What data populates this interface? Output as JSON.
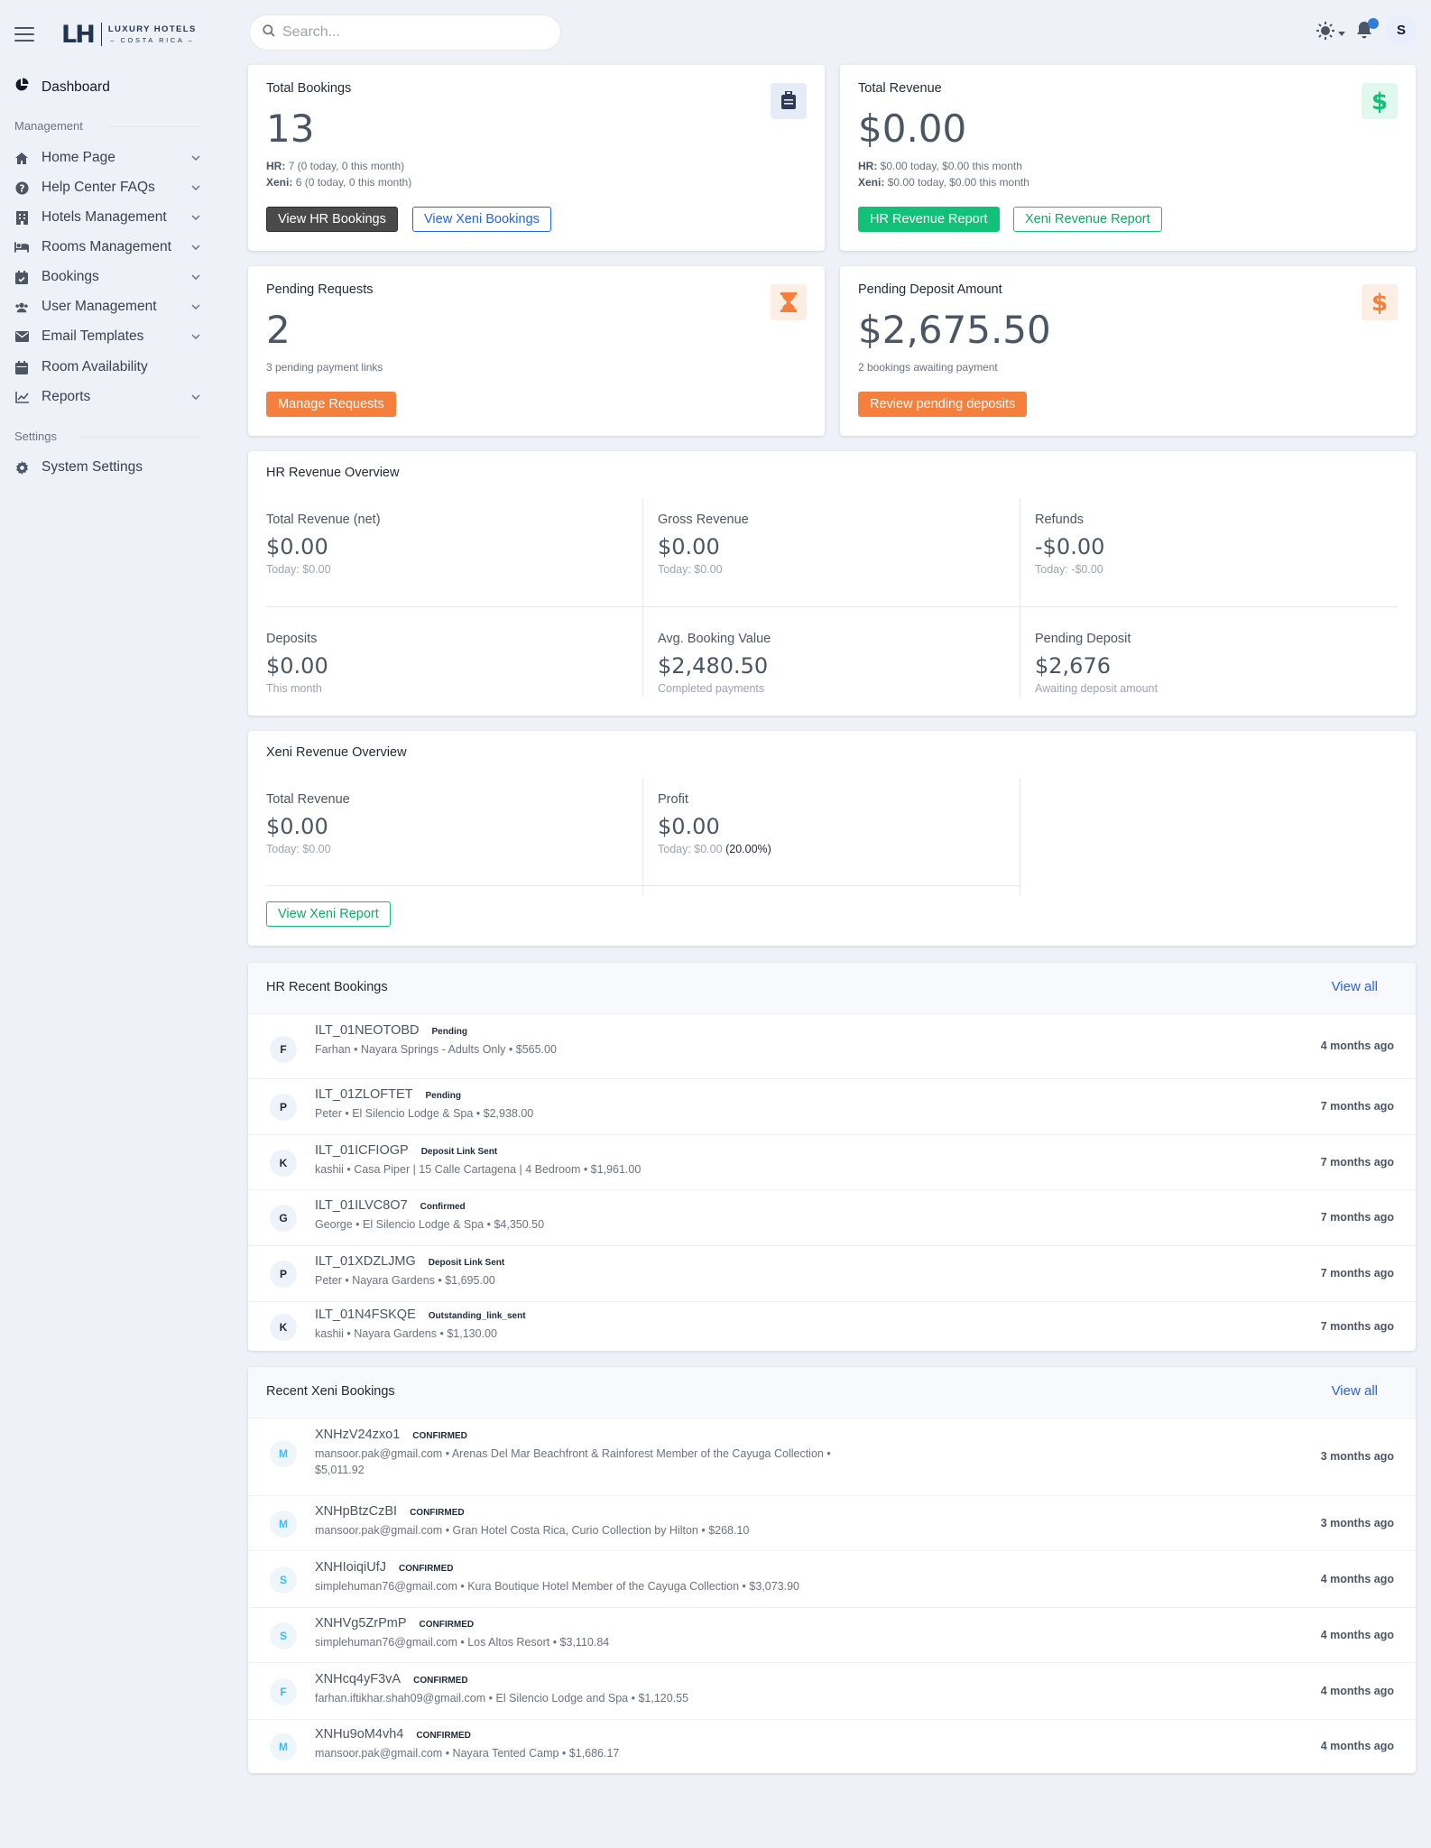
{
  "brand": {
    "mark": "LH",
    "line1": "LUXURY HOTELS",
    "line2": "– COSTA RICA –"
  },
  "sidebar": {
    "dashboard": "Dashboard",
    "management_label": "Management",
    "items": [
      {
        "label": "Home Page"
      },
      {
        "label": "Help Center FAQs"
      },
      {
        "label": "Hotels Management"
      },
      {
        "label": "Rooms Management"
      },
      {
        "label": "Bookings"
      },
      {
        "label": "User Management"
      },
      {
        "label": "Email Templates"
      },
      {
        "label": "Room Availability"
      },
      {
        "label": "Reports"
      }
    ],
    "settings_label": "Settings",
    "system_settings": "System Settings"
  },
  "topbar": {
    "search_placeholder": "Search...",
    "avatar_initial": "S"
  },
  "cards": {
    "total_bookings": {
      "title": "Total Bookings",
      "value": "13",
      "hr_label": "HR:",
      "hr_text": "7 (0 today, 0 this month)",
      "xeni_label": "Xeni:",
      "xeni_text": "6 (0 today, 0 this month)",
      "btn1": "View HR Bookings",
      "btn2": "View Xeni Bookings"
    },
    "total_revenue": {
      "title": "Total Revenue",
      "value": "$0.00",
      "hr_label": "HR:",
      "hr_text": "$0.00 today, $0.00 this month",
      "xeni_label": "Xeni:",
      "xeni_text": "$0.00 today, $0.00 this month",
      "btn1": "HR Revenue Report",
      "btn2": "Xeni Revenue Report"
    },
    "pending_requests": {
      "title": "Pending Requests",
      "value": "2",
      "sub": "3 pending payment links",
      "btn": "Manage Requests"
    },
    "pending_deposit": {
      "title": "Pending Deposit Amount",
      "value": "$2,675.50",
      "sub": "2 bookings awaiting payment",
      "btn": "Review pending deposits"
    }
  },
  "hr_overview": {
    "title": "HR Revenue Overview",
    "cells": [
      {
        "label": "Total Revenue (net)",
        "value": "$0.00",
        "sub": "Today: $0.00"
      },
      {
        "label": "Gross Revenue",
        "value": "$0.00",
        "sub": "Today: $0.00"
      },
      {
        "label": "Refunds",
        "value": "-$0.00",
        "sub": "Today: -$0.00"
      },
      {
        "label": "Deposits",
        "value": "$0.00",
        "sub": "This month"
      },
      {
        "label": "Avg. Booking Value",
        "value": "$2,480.50",
        "sub": "Completed payments"
      },
      {
        "label": "Pending Deposit",
        "value": "$2,676",
        "sub": "Awaiting deposit amount"
      }
    ]
  },
  "xeni_overview": {
    "title": "Xeni Revenue Overview",
    "cells": [
      {
        "label": "Total Revenue",
        "value": "$0.00",
        "sub": "Today: $0.00"
      },
      {
        "label": "Profit",
        "value": "$0.00",
        "sub": "Today: $0.00",
        "pct": "(20.00%)"
      }
    ],
    "button": "View Xeni Report"
  },
  "hr_bookings": {
    "title": "HR Recent Bookings",
    "view_all": "View all",
    "rows": [
      {
        "initial": "F",
        "code": "ILT_01NEOTOBD",
        "status": "Pending",
        "detail": "Farhan • Nayara Springs - Adults Only • $565.00",
        "time": "4 months ago"
      },
      {
        "initial": "P",
        "code": "ILT_01ZLOFTET",
        "status": "Pending",
        "detail": "Peter • El Silencio Lodge & Spa • $2,938.00",
        "time": "7 months ago"
      },
      {
        "initial": "K",
        "code": "ILT_01ICFIOGP",
        "status": "Deposit Link Sent",
        "detail": "kashii • Casa Piper | 15 Calle Cartagena | 4 Bedroom • $1,961.00",
        "time": "7 months ago"
      },
      {
        "initial": "G",
        "code": "ILT_01ILVC8O7",
        "status": "Confirmed",
        "detail": "George • El Silencio Lodge & Spa • $4,350.50",
        "time": "7 months ago"
      },
      {
        "initial": "P",
        "code": "ILT_01XDZLJMG",
        "status": "Deposit Link Sent",
        "detail": "Peter • Nayara Gardens • $1,695.00",
        "time": "7 months ago"
      },
      {
        "initial": "K",
        "code": "ILT_01N4FSKQE",
        "status": "Outstanding_link_sent",
        "detail": "kashii • Nayara Gardens • $1,130.00",
        "time": "7 months ago"
      }
    ]
  },
  "xeni_bookings": {
    "title": "Recent Xeni Bookings",
    "view_all": "View all",
    "rows": [
      {
        "initial": "M",
        "code": "XNHzV24zxo1",
        "status": "CONFIRMED",
        "detail": "mansoor.pak@gmail.com • Arenas Del Mar Beachfront & Rainforest Member of the Cayuga Collection • $5,011.92",
        "time": "3 months ago"
      },
      {
        "initial": "M",
        "code": "XNHpBtzCzBI",
        "status": "CONFIRMED",
        "detail": "mansoor.pak@gmail.com • Gran Hotel Costa Rica, Curio Collection by Hilton • $268.10",
        "time": "3 months ago"
      },
      {
        "initial": "S",
        "code": "XNHIoiqiUfJ",
        "status": "CONFIRMED",
        "detail": "simplehuman76@gmail.com • Kura Boutique Hotel Member of the Cayuga Collection • $3,073.90",
        "time": "4 months ago"
      },
      {
        "initial": "S",
        "code": "XNHVg5ZrPmP",
        "status": "CONFIRMED",
        "detail": "simplehuman76@gmail.com • Los Altos Resort • $3,110.84",
        "time": "4 months ago"
      },
      {
        "initial": "F",
        "code": "XNHcq4yF3vA",
        "status": "CONFIRMED",
        "detail": "farhan.iftikhar.shah09@gmail.com • El Silencio Lodge and Spa • $1,120.55",
        "time": "4 months ago"
      },
      {
        "initial": "M",
        "code": "XNHu9oM4vh4",
        "status": "CONFIRMED",
        "detail": "mansoor.pak@gmail.com • Nayara Tented Camp • $1,686.17",
        "time": "4 months ago"
      }
    ]
  },
  "colors": {
    "green": "#12c178",
    "orange": "#f5803e",
    "dark": "#4a4a4a",
    "blue": "#2563eb",
    "navy": "#1f3550"
  }
}
